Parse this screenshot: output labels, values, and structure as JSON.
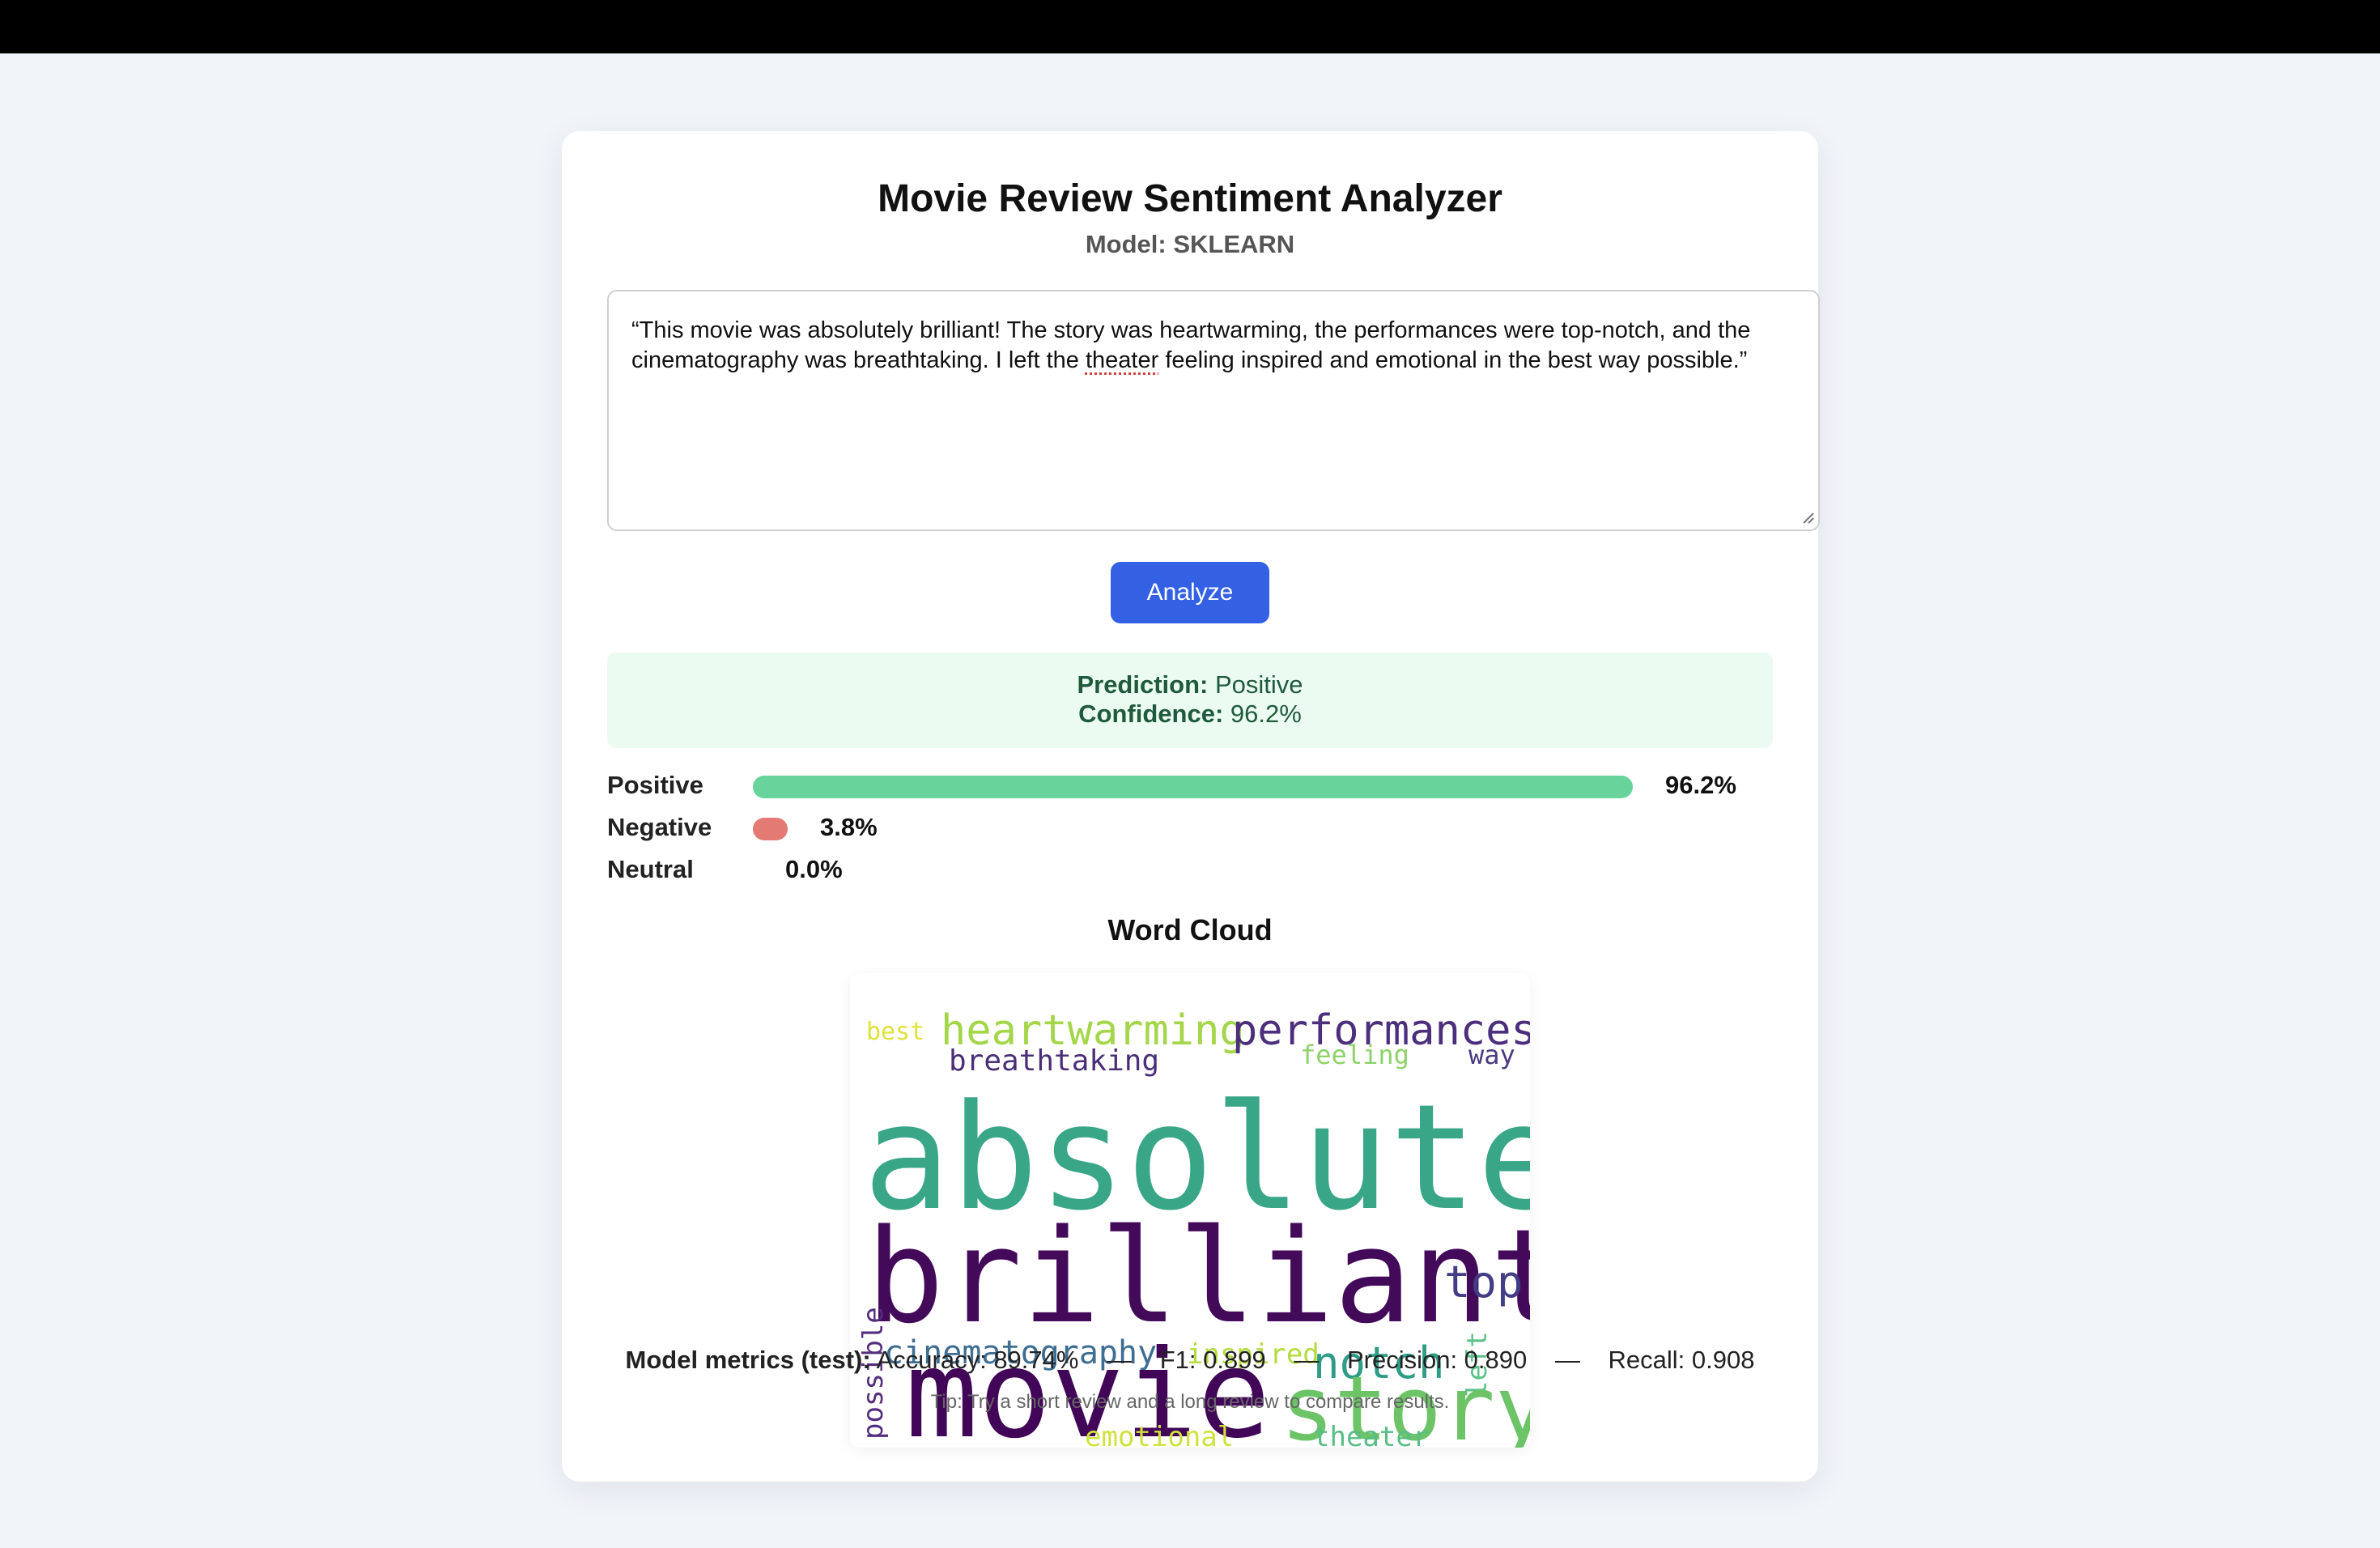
{
  "app": {
    "title": "Movie Review Sentiment Analyzer",
    "model_label": "Model:",
    "model_name": "SKLEARN"
  },
  "review": {
    "text_before": "“This movie was absolutely brilliant! The story was heartwarming, the performances were top-notch, and the cinematography was breathtaking. I left the ",
    "misspelled_word": "theater",
    "text_after": " feeling inspired and emotional in the best way possible.”"
  },
  "analyze_button": {
    "label": "Analyze"
  },
  "result": {
    "prediction_label": "Prediction:",
    "prediction_value": "Positive",
    "confidence_label": "Confidence:",
    "confidence_value": "96.2%"
  },
  "probabilities": [
    {
      "label": "Positive",
      "value": 0.962,
      "display": "96.2%",
      "color": "#68d39b"
    },
    {
      "label": "Negative",
      "value": 0.038,
      "display": "3.8%",
      "color": "#e47a74"
    },
    {
      "label": "Neutral",
      "value": 0.0,
      "display": "0.0%",
      "color": "#b0b0b0"
    }
  ],
  "wordcloud": {
    "title": "Word Cloud",
    "words": [
      {
        "text": "best",
        "color": "#dfe23a"
      },
      {
        "text": "heartwarming",
        "color": "#a4d64a"
      },
      {
        "text": "performances",
        "color": "#4b2f7c"
      },
      {
        "text": "breathtaking",
        "color": "#4a2e78"
      },
      {
        "text": "feeling",
        "color": "#8dd268"
      },
      {
        "text": "way",
        "color": "#4b3a80"
      },
      {
        "text": "absolutely",
        "color": "#3aa688"
      },
      {
        "text": "brilliant",
        "color": "#440a5a"
      },
      {
        "text": "top",
        "color": "#433d86"
      },
      {
        "text": "cinematography",
        "color": "#3e6e92"
      },
      {
        "text": "inspired",
        "color": "#b3dc3c"
      },
      {
        "text": "notch",
        "color": "#2e9c86"
      },
      {
        "text": "left",
        "color": "#5cc189"
      },
      {
        "text": "possible",
        "color": "#542d7e"
      },
      {
        "text": "movie",
        "color": "#410657"
      },
      {
        "text": "story",
        "color": "#6cc467"
      },
      {
        "text": "emotional",
        "color": "#cfe23b"
      },
      {
        "text": "theater",
        "color": "#58bd86"
      }
    ]
  },
  "metrics": {
    "label": "Model metrics (test):",
    "accuracy": "Accuracy: 89.74%",
    "f1": "F1: 0.899",
    "precision": "Precision: 0.890",
    "recall": "Recall: 0.908",
    "separator": "—"
  },
  "tip": "Tip: Try a short review and a long review to compare results."
}
